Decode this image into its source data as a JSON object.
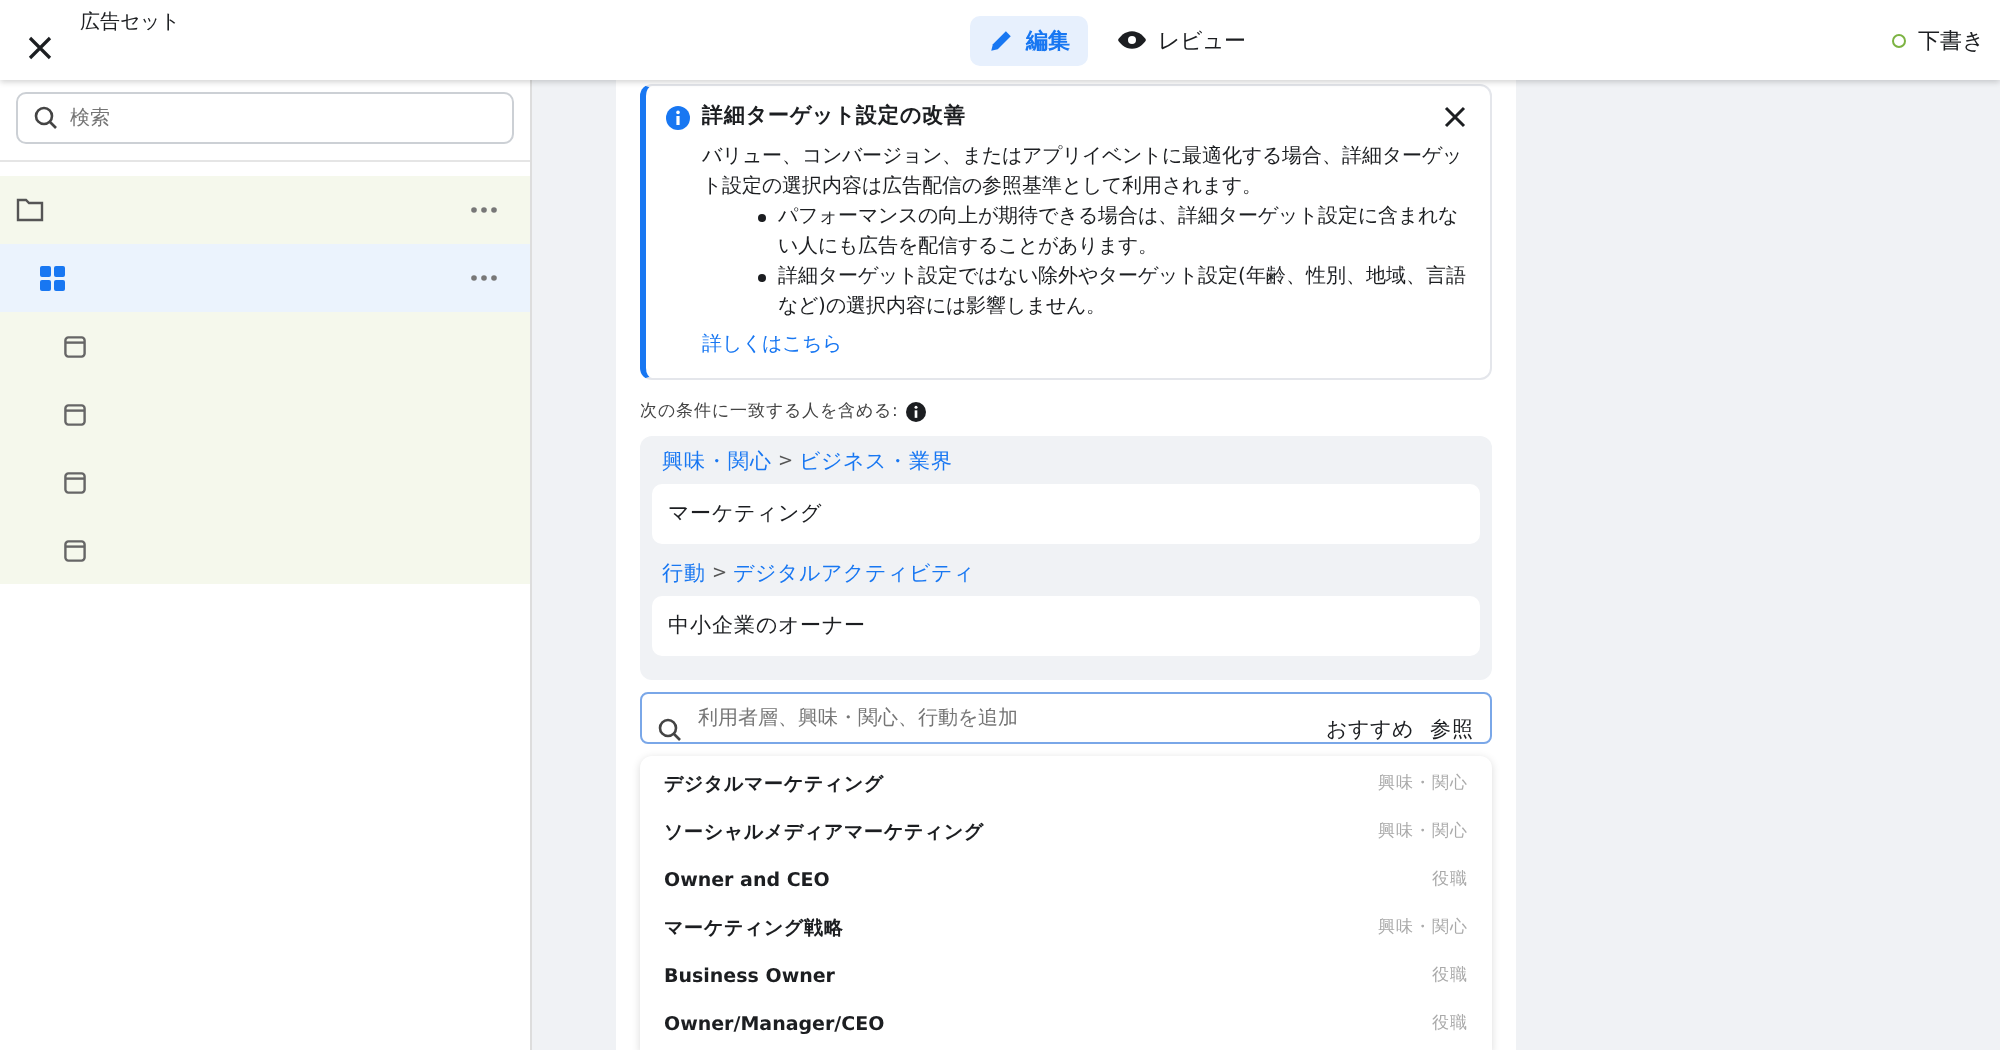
{
  "header": {
    "title": "広告セット",
    "tabs": [
      {
        "label": "編集",
        "kind": "edit",
        "selected": true
      },
      {
        "label": "レビュー",
        "kind": "review",
        "selected": false
      }
    ],
    "status": "下書き"
  },
  "sidebar": {
    "search": {
      "placeholder": "検索"
    },
    "tree": [
      {
        "kind": "campaign",
        "selected": false,
        "children": [
          {
            "kind": "adset",
            "selected": true,
            "children": [
              {
                "kind": "ad",
                "selected": false
              },
              {
                "kind": "ad",
                "selected": false
              },
              {
                "kind": "ad",
                "selected": false
              },
              {
                "kind": "ad",
                "selected": false
              }
            ]
          }
        ]
      }
    ]
  },
  "notice": {
    "title": "詳細ターゲット設定の改善",
    "body": "バリュー、コンバージョン、またはアプリイベントに最適化する場合、詳細ターゲット設定の選択内容は広告配信の参照基準として利用されます。",
    "bullets": [
      "パフォーマンスの向上が期待できる場合は、詳細ターゲット設定に含まれない人にも広告を配信することがあります。",
      "詳細ターゲット設定ではない除外やターゲット設定(年齢、性別、地域、言語など)の選択内容には影響しません。"
    ],
    "link": "詳しくはこちら"
  },
  "include": {
    "label": "次の条件に一致する人を含める:",
    "groups": [
      {
        "category": "興味・関心",
        "separator": ">",
        "subcategory": "ビジネス・業界",
        "items": [
          "マーケティング"
        ]
      },
      {
        "category": "行動",
        "separator": ">",
        "subcategory": "デジタルアクティビティ",
        "items": [
          "中小企業のオーナー"
        ]
      }
    ]
  },
  "search": {
    "placeholder": "利用者層、興味・関心、行動を追加",
    "actions": [
      "おすすめ",
      "参照"
    ]
  },
  "suggestions": [
    {
      "name": "デジタルマーケティング",
      "type": "興味・関心"
    },
    {
      "name": "ソーシャルメディアマーケティング",
      "type": "興味・関心"
    },
    {
      "name": "Owner and CEO",
      "type": "役職"
    },
    {
      "name": "マーケティング戦略",
      "type": "興味・関心"
    },
    {
      "name": "Business Owner",
      "type": "役職"
    },
    {
      "name": "Owner/Manager/CEO",
      "type": "役職"
    }
  ]
}
